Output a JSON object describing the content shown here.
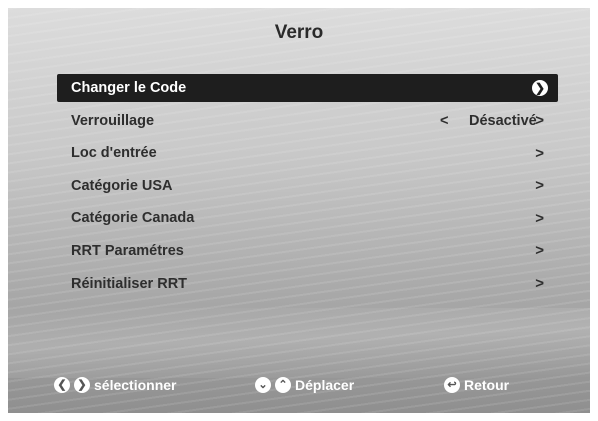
{
  "screen": {
    "title": "Verro"
  },
  "menu": {
    "items": [
      {
        "label": "Changer le Code",
        "value": "",
        "selected": true
      },
      {
        "label": "Verrouillage",
        "value": "Désactivé",
        "selected": false
      },
      {
        "label": "Loc d'entrée",
        "value": "",
        "selected": false
      },
      {
        "label": "Catégorie USA",
        "value": "",
        "selected": false
      },
      {
        "label": "Catégorie Canada",
        "value": "",
        "selected": false
      },
      {
        "label": "RRT Paramétres",
        "value": "",
        "selected": false
      },
      {
        "label": "Réinitialiser RRT",
        "value": "",
        "selected": false
      }
    ],
    "arrow_right": ">",
    "arrow_left": "<"
  },
  "footer": {
    "select_label": "sélectionner",
    "move_label": "Déplacer",
    "back_label": "Retour",
    "icons": {
      "select": [
        "chevron-left-icon",
        "chevron-right-icon"
      ],
      "move": [
        "chevron-down-icon",
        "chevron-up-icon"
      ],
      "back": "return-icon"
    }
  },
  "colors": {
    "selected_bg": "#1e1e1e",
    "text": "#2e2e2e",
    "footer_text": "#ffffff"
  }
}
